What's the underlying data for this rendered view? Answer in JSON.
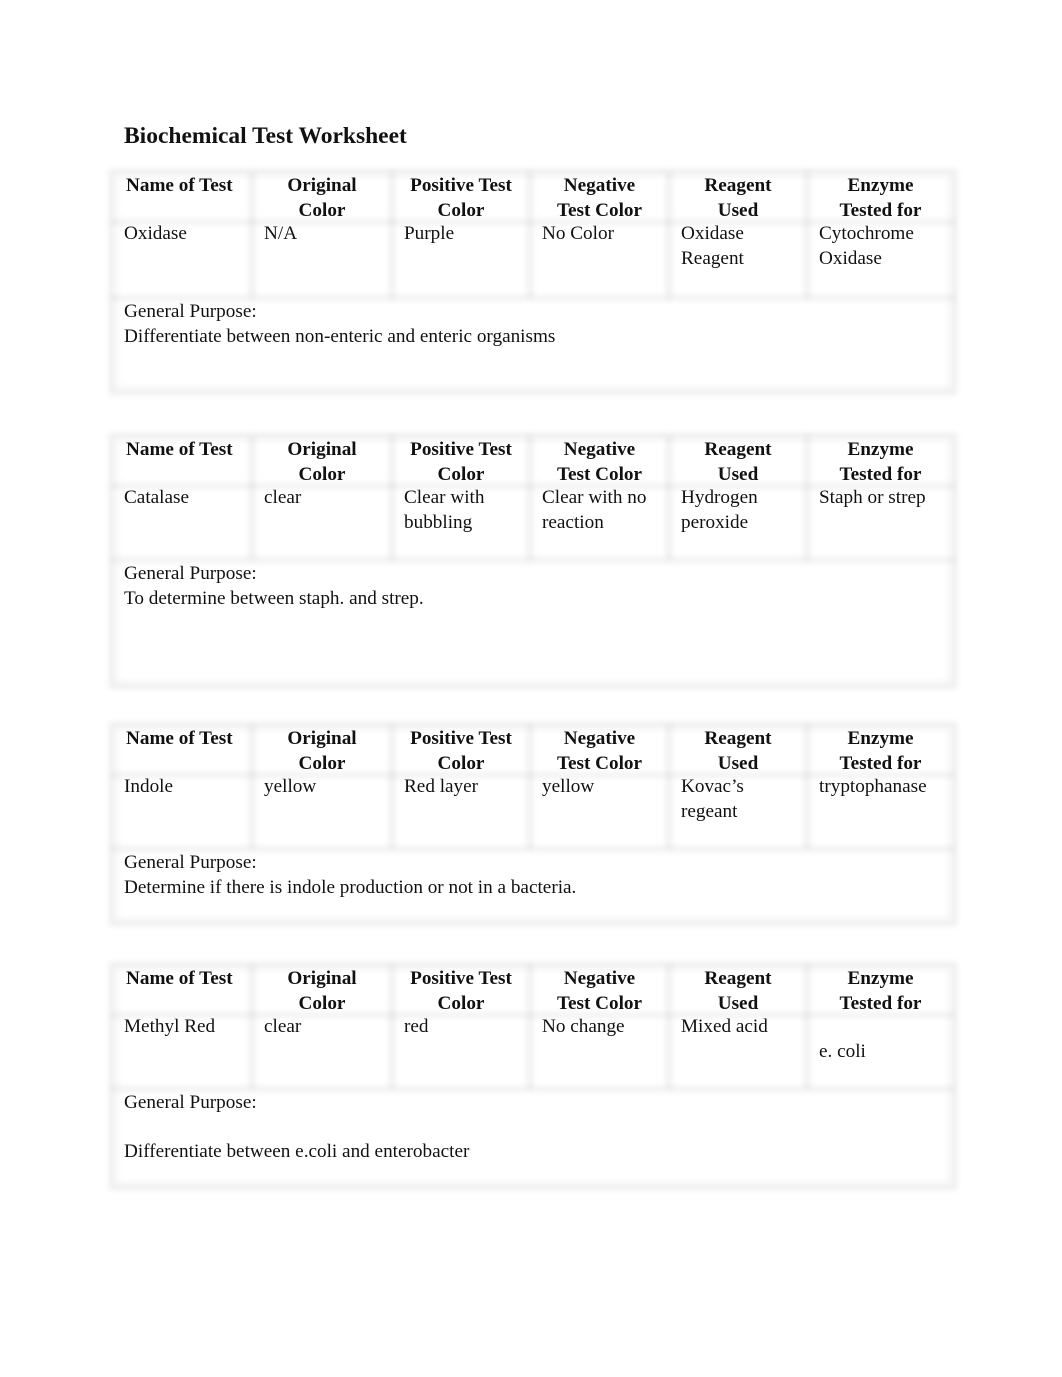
{
  "document": {
    "title": "Biochemical Test Worksheet",
    "headers": [
      "Name of Test",
      "Original Color",
      "Positive Test Color",
      "Negative Test Color",
      "Reagent Used",
      "Enzyme Tested for"
    ],
    "header_lines": [
      [
        "Name of Test",
        ""
      ],
      [
        "Original",
        "Color"
      ],
      [
        "Positive Test",
        "Color"
      ],
      [
        "Negative",
        "Test Color"
      ],
      [
        "Reagent",
        "Used"
      ],
      [
        "Enzyme",
        "Tested for"
      ]
    ],
    "purpose_label": "General Purpose:",
    "tests": [
      {
        "name": "Oxidase",
        "original_color": "N/A",
        "positive_color": "Purple",
        "negative_color": "No Color",
        "reagent": "Oxidase Reagent",
        "reagent_lines": [
          "Oxidase",
          "Reagent"
        ],
        "enzyme": "Cytochrome Oxidase",
        "enzyme_lines": [
          "Cytochrome",
          "Oxidase"
        ],
        "purpose": "Differentiate between non-enteric and enteric organisms"
      },
      {
        "name": "Catalase",
        "original_color": "clear",
        "positive_color": "Clear with bubbling",
        "positive_lines": [
          "Clear with",
          "bubbling"
        ],
        "negative_color": "Clear with no reaction",
        "negative_lines": [
          "Clear with no",
          "reaction"
        ],
        "reagent": "Hydrogen peroxide",
        "reagent_lines": [
          "Hydrogen",
          "peroxide"
        ],
        "enzyme": "Staph or strep",
        "purpose": "To determine between staph. and strep."
      },
      {
        "name": "Indole",
        "original_color": "yellow",
        "positive_color": "Red layer",
        "negative_color": "yellow",
        "reagent": "Kovac’s regeant",
        "reagent_lines": [
          "Kovac’s",
          "regeant"
        ],
        "enzyme": "tryptophanase",
        "purpose": "Determine if there is indole production or not in a bacteria."
      },
      {
        "name": "Methyl Red",
        "original_color": "clear",
        "positive_color": "red",
        "negative_color": "No change",
        "reagent": "Mixed acid",
        "enzyme": "e. coli",
        "purpose": "Differentiate between e.coli and enterobacter"
      }
    ]
  }
}
